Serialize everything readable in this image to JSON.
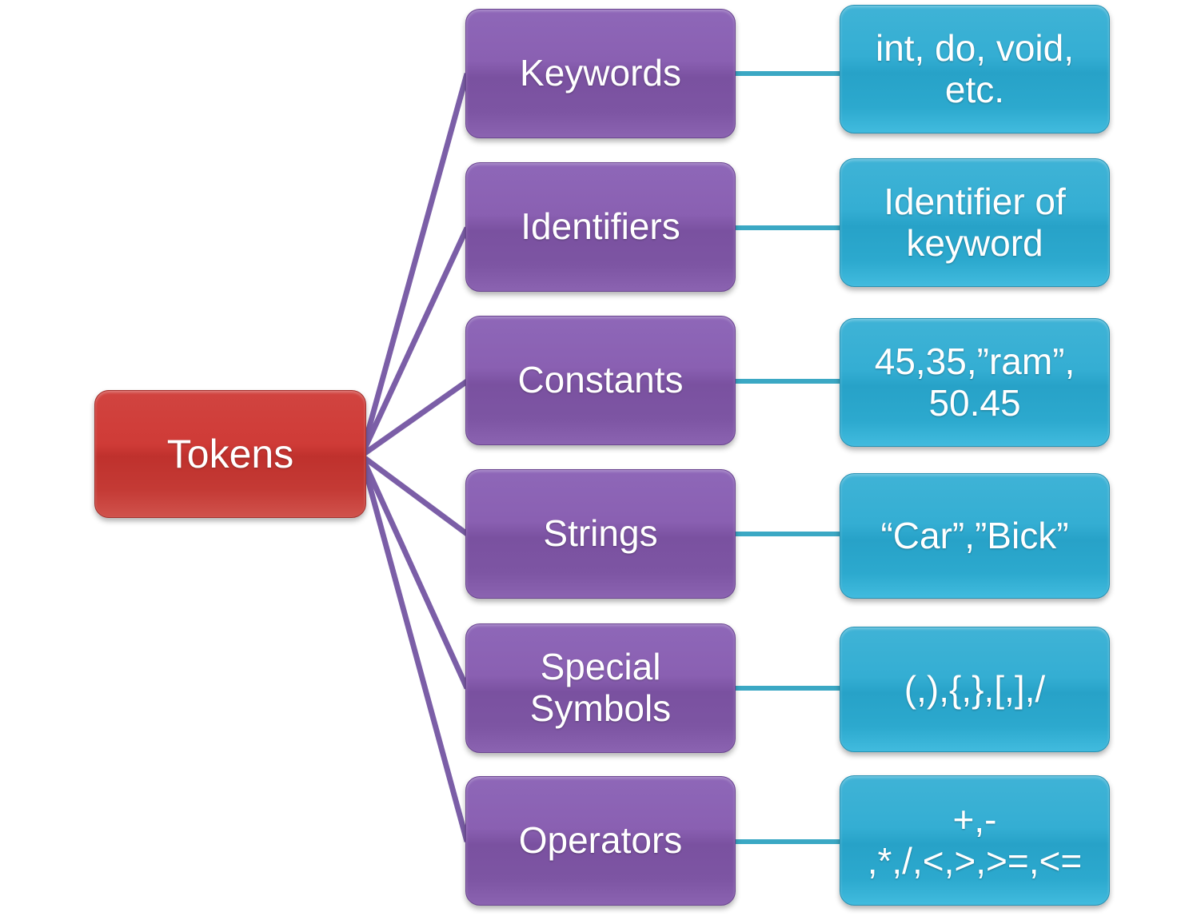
{
  "diagram": {
    "title": "Tokens classification diagram",
    "root": {
      "label": "Tokens",
      "color": "#c43a35"
    },
    "category_color": "#7d55a3",
    "value_color": "#2ca9ce",
    "root_edge_color": "#7b5ea7",
    "value_edge_color": "#3ba8c4",
    "rows": [
      {
        "category": "Keywords",
        "value": "int, do, void, etc."
      },
      {
        "category": "Identifiers",
        "value": "Identifier of keyword"
      },
      {
        "category": "Constants",
        "value": "45,35,”ram”, 50.45"
      },
      {
        "category": "Strings",
        "value": "“Car”,”Bick”"
      },
      {
        "category": "Special Symbols",
        "value": "(,),{,},[,],/"
      },
      {
        "category": "Operators",
        "value": "+,-\n,*,/,<,>,>=,<="
      }
    ]
  }
}
